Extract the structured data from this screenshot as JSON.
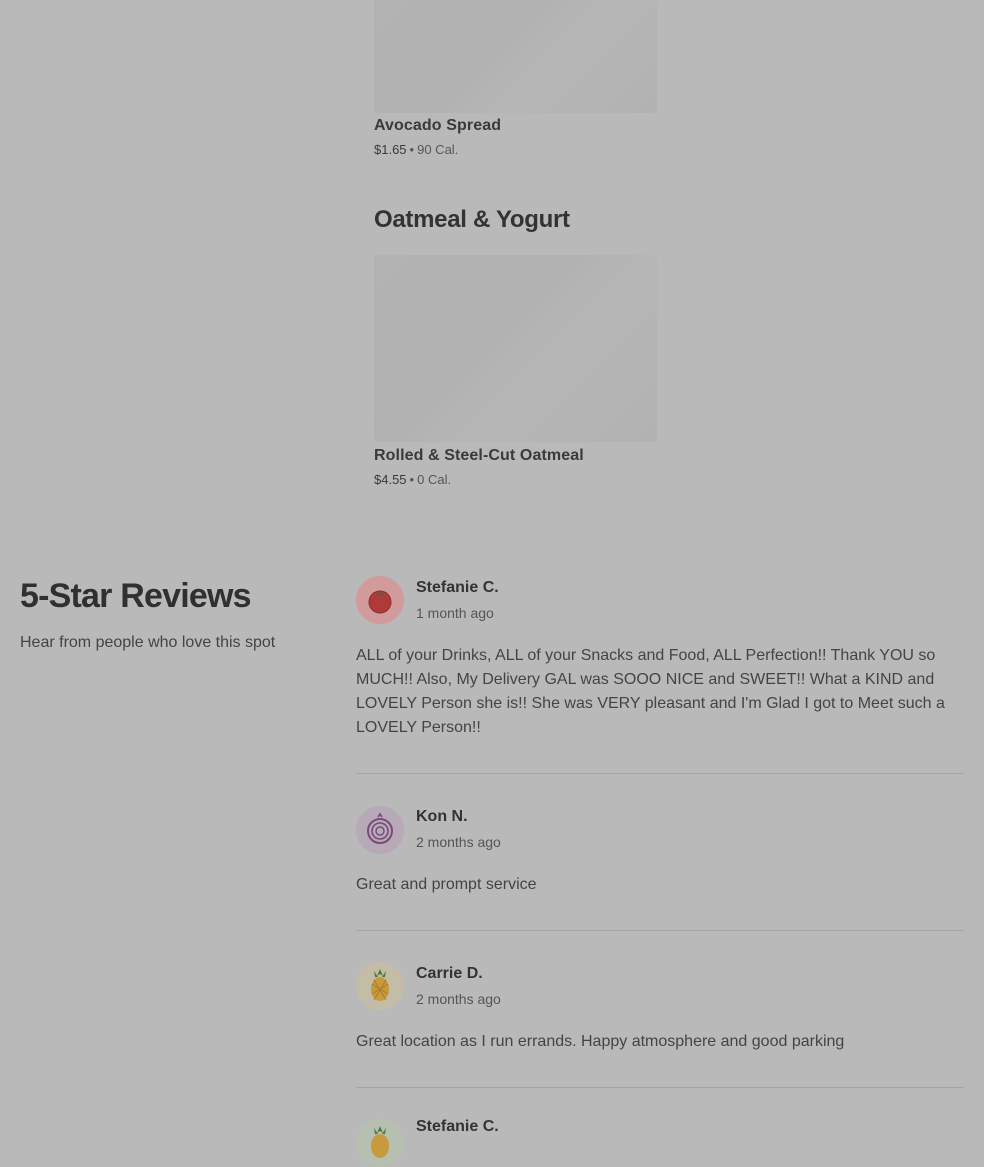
{
  "menu": {
    "items_above": [
      {
        "name": "Avocado Spread",
        "price": "$1.65",
        "calories": "90 Cal."
      }
    ],
    "section": {
      "title": "Oatmeal & Yogurt",
      "items": [
        {
          "name": "Rolled & Steel-Cut Oatmeal",
          "price": "$4.55",
          "calories": "0 Cal."
        }
      ]
    },
    "separator": "•"
  },
  "reviews": {
    "title": "5-Star Reviews",
    "subtitle": "Hear from people who love this spot",
    "list": [
      {
        "name": "Stefanie C.",
        "time": "1 month ago",
        "avatar_icon": "tomato-icon",
        "avatar_bg": "#d29b9b",
        "text": "ALL of your Drinks, ALL of your Snacks and Food, ALL Perfection!! Thank YOU so MUCH!! Also, My Delivery GAL was SOOO NICE and SWEET!! What a KIND and LOVELY Person she is!! She was VERY pleasant and I'm Glad I got to Meet such a LOVELY Person!!"
      },
      {
        "name": "Kon N.",
        "time": "2 months ago",
        "avatar_icon": "onion-icon",
        "avatar_bg": "#b7a9b8",
        "text": "Great and prompt service"
      },
      {
        "name": "Carrie D.",
        "time": "2 months ago",
        "avatar_icon": "pineapple-icon",
        "avatar_bg": "#c3bca7",
        "text": "Great location as I run errands. Happy atmosphere and good parking"
      },
      {
        "name": "Stefanie C.",
        "avatar_icon": "pineapple-icon",
        "avatar_bg": "#b7bfb0"
      }
    ]
  }
}
